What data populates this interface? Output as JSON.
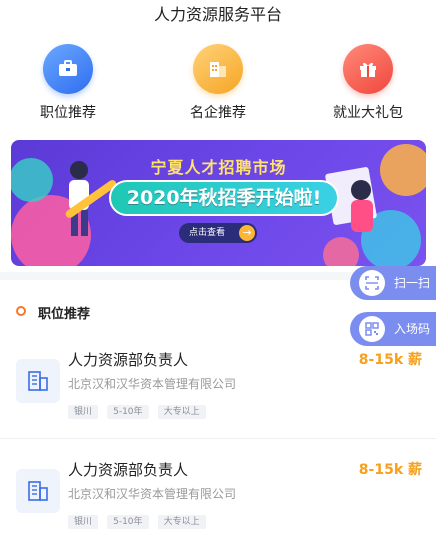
{
  "header": {
    "title": "人力资源服务平台"
  },
  "nav": [
    {
      "label": "职位推荐",
      "icon": "briefcase-icon",
      "color": "#2f6ef0"
    },
    {
      "label": "名企推荐",
      "icon": "building-icon",
      "color": "#f6a523"
    },
    {
      "label": "就业大礼包",
      "icon": "gift-icon",
      "color": "#f0473c"
    }
  ],
  "banner": {
    "title": "宁夏人才招聘市场",
    "subtitle": "2020年秋招季开始啦!",
    "button_label": "点击查看",
    "button_arrow": "→"
  },
  "floating": [
    {
      "label": "扫一扫",
      "icon": "scan-icon"
    },
    {
      "label": "入场码",
      "icon": "qrcode-icon"
    }
  ],
  "section": {
    "title": "职位推荐"
  },
  "jobs": [
    {
      "title": "人力资源部负责人",
      "salary": "8-15k 薪",
      "company": "北京汉和汉华资本管理有限公司",
      "tags": [
        "银川",
        "5-10年",
        "大专以上"
      ]
    },
    {
      "title": "人力资源部负责人",
      "salary": "8-15k 薪",
      "company": "北京汉和汉华资本管理有限公司",
      "tags": [
        "银川",
        "5-10年",
        "大专以上"
      ]
    }
  ],
  "colors": {
    "accent": "#f7a01c",
    "float_bg": "#7b8ef0",
    "banner_bg": "#6c46e8"
  }
}
